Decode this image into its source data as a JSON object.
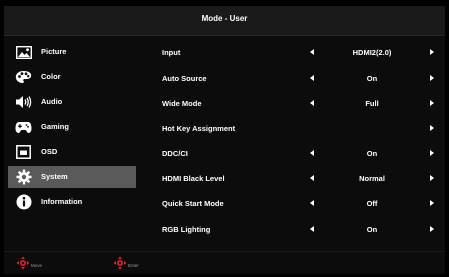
{
  "header": {
    "title": "Mode - User"
  },
  "sidebar": {
    "items": [
      {
        "label": "Picture",
        "icon": "picture-icon"
      },
      {
        "label": "Color",
        "icon": "palette-icon"
      },
      {
        "label": "Audio",
        "icon": "speaker-icon"
      },
      {
        "label": "Gaming",
        "icon": "gamepad-icon"
      },
      {
        "label": "OSD",
        "icon": "osd-icon"
      },
      {
        "label": "System",
        "icon": "gear-icon",
        "selected": true
      },
      {
        "label": "Information",
        "icon": "info-icon"
      }
    ]
  },
  "settings": {
    "rows": [
      {
        "label": "Input",
        "value": "HDMI2(2.0)",
        "has_left_arrow": true
      },
      {
        "label": "Auto Source",
        "value": "On",
        "has_left_arrow": true
      },
      {
        "label": "Wide Mode",
        "value": "Full",
        "has_left_arrow": true
      },
      {
        "label": "Hot Key Assignment",
        "value": "",
        "has_left_arrow": false
      },
      {
        "label": "DDC/CI",
        "value": "On",
        "has_left_arrow": true
      },
      {
        "label": "HDMI Black Level",
        "value": "Normal",
        "has_left_arrow": true
      },
      {
        "label": "Quick Start Mode",
        "value": "Off",
        "has_left_arrow": true
      },
      {
        "label": "RGB Lighting",
        "value": "On",
        "has_left_arrow": true
      }
    ]
  },
  "footer": {
    "move_label": "Move",
    "enter_label": "Enter"
  },
  "colors": {
    "background": "#0c0c0c",
    "selected": "#5a5a5a",
    "text": "#ffffff",
    "accent": "#d8232a"
  }
}
